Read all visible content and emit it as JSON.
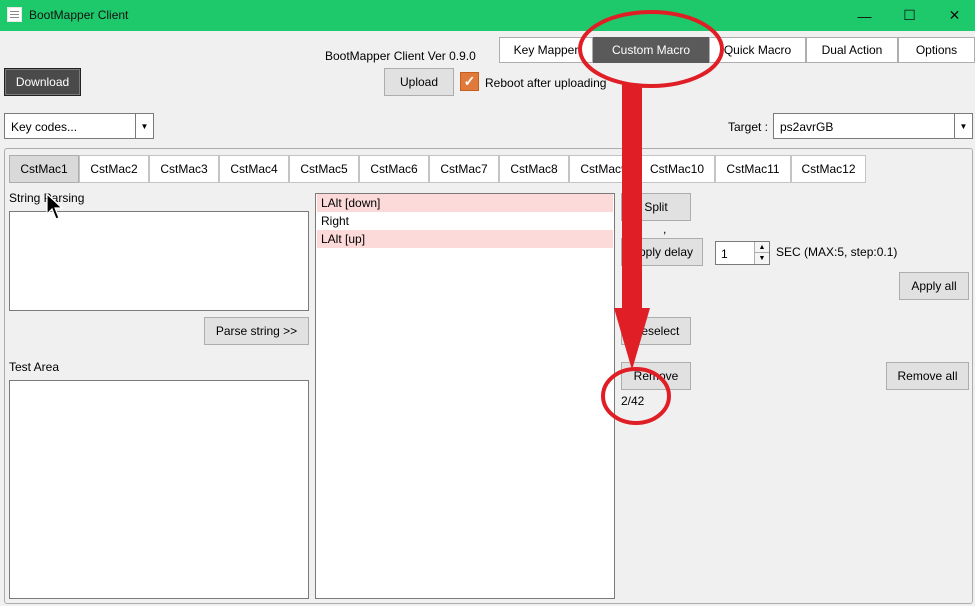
{
  "window": {
    "title": "BootMapper Client",
    "minimize": "—",
    "maximize": "☐",
    "close": "✕"
  },
  "version_label": "BootMapper Client Ver 0.9.0",
  "top_tabs": [
    {
      "label": "Key Mapper",
      "active": false
    },
    {
      "label": "Custom Macro",
      "active": true
    },
    {
      "label": "Quick Macro",
      "active": false
    },
    {
      "label": "Dual Action",
      "active": false
    },
    {
      "label": "Options",
      "active": false
    }
  ],
  "toolbar": {
    "download_label": "Download",
    "upload_label": "Upload",
    "reboot_label": "Reboot after uploading",
    "reboot_checked": true
  },
  "key_codes": {
    "selected": "Key codes..."
  },
  "target": {
    "label": "Target :",
    "selected": "ps2avrGB"
  },
  "sub_tabs": [
    "CstMac1",
    "CstMac2",
    "CstMac3",
    "CstMac4",
    "CstMac5",
    "CstMac6",
    "CstMac7",
    "CstMac8",
    "CstMac9",
    "CstMac10",
    "CstMac11",
    "CstMac12"
  ],
  "left": {
    "string_parsing_label": "String Parsing",
    "parse_button": "Parse string >>",
    "test_area_label": "Test Area"
  },
  "macro_list": [
    {
      "text": "LAlt [down]",
      "highlight": true
    },
    {
      "text": "Right",
      "highlight": false
    },
    {
      "text": "LAlt [up]",
      "highlight": true
    }
  ],
  "right": {
    "split_label": "Split",
    "apply_delay_label": "Apply delay",
    "delay_value": "1",
    "delay_hint": "SEC (MAX:5, step:0.1)",
    "apply_all_label": "Apply all",
    "deselect_label": "Deselect",
    "remove_label": "Remove",
    "remove_all_label": "Remove all",
    "count": "2/42",
    "comma": ","
  },
  "colors": {
    "titlebar": "#1ec96b",
    "active_tab": "#5a5a5a",
    "highlight_row": "#fddada",
    "annotation": "#e01e25",
    "checkbox": "#e07a3a"
  }
}
